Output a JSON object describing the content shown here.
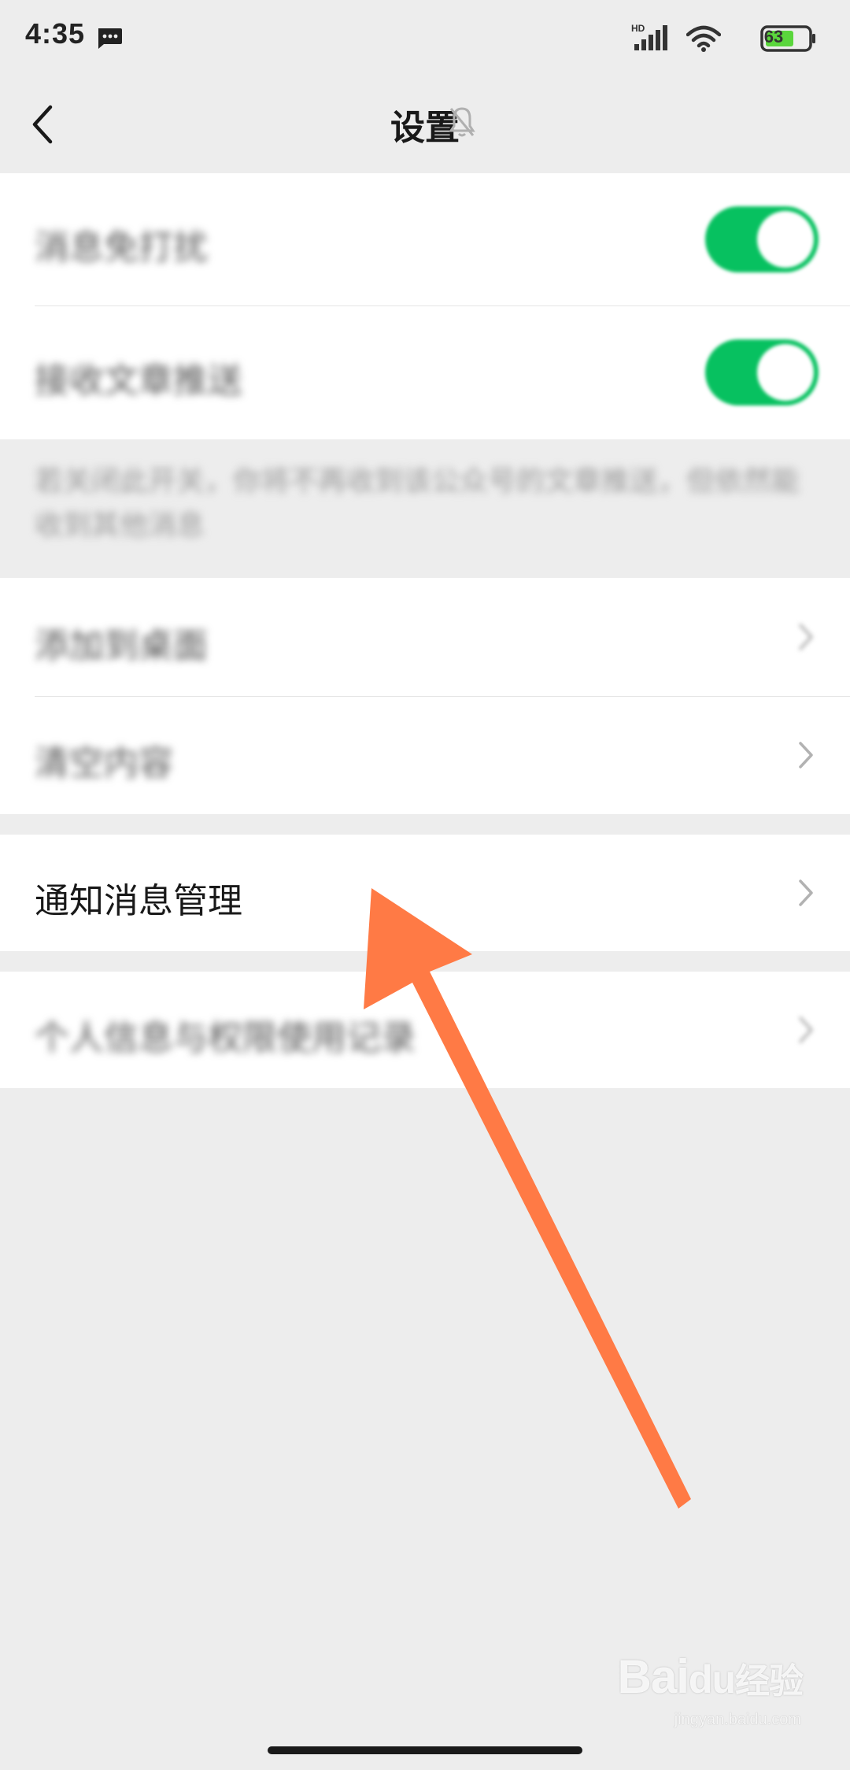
{
  "status_bar": {
    "time": "4:35",
    "network": "HD",
    "battery": "63"
  },
  "nav": {
    "title": "设置"
  },
  "group1": {
    "row1_label": "消息免打扰",
    "row2_label": "接收文章推送",
    "description": "若关闭此开关，你将不再收到该公众号的文章推送，但依然能收到其他消息"
  },
  "group2": {
    "row1_label": "添加到桌面",
    "row2_label": "清空内容"
  },
  "group3": {
    "row1_label": "通知消息管理"
  },
  "group4": {
    "row1_label": "个人信息与权限使用记录"
  },
  "watermark": {
    "brand": "Bai",
    "brand2": "经验",
    "url": "jingyan.baidu.com"
  },
  "colors": {
    "toggle_on": "#07c160",
    "arrow": "#ff7a45",
    "background": "#ededed"
  }
}
